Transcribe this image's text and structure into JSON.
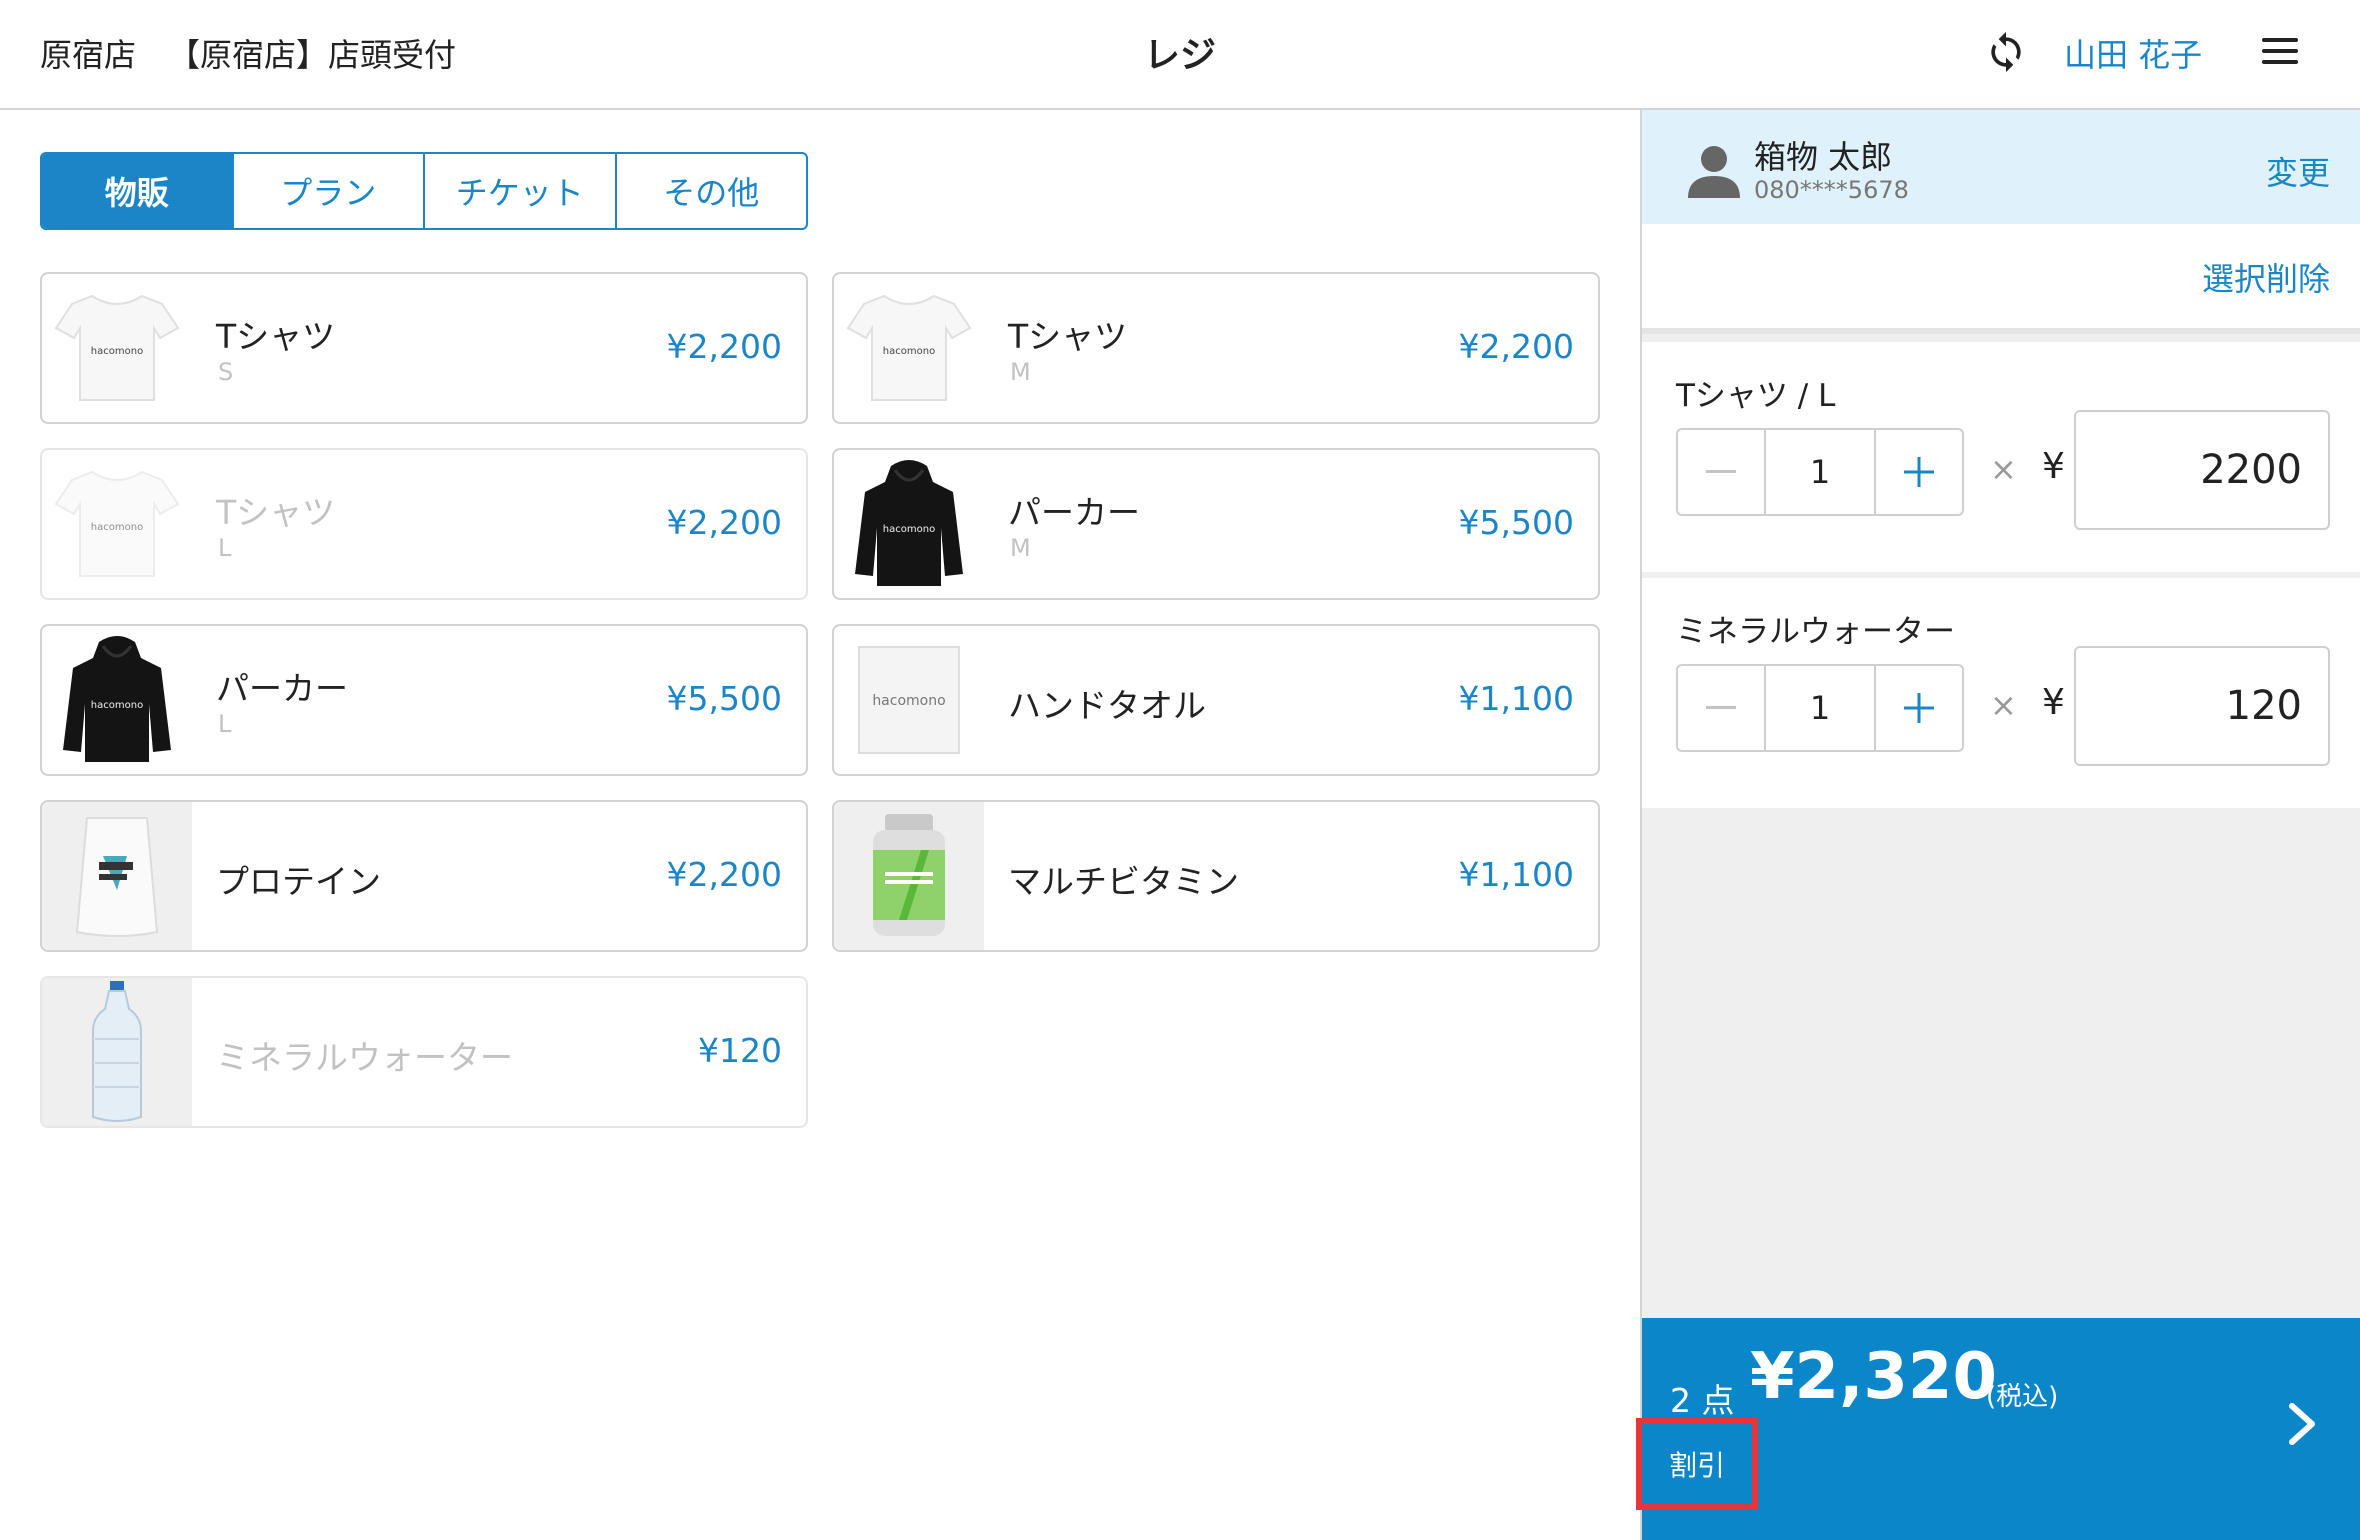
{
  "header": {
    "store": "原宿店",
    "reception": "【原宿店】店頭受付",
    "title": "レジ",
    "user": "山田 花子"
  },
  "tabs": [
    "物販",
    "プラン",
    "チケット",
    "その他"
  ],
  "products": [
    {
      "name": "Tシャツ",
      "variant": "S",
      "price": "¥2,200",
      "icon": "tshirt-white"
    },
    {
      "name": "Tシャツ",
      "variant": "M",
      "price": "¥2,200",
      "icon": "tshirt-white"
    },
    {
      "name": "Tシャツ",
      "variant": "L",
      "price": "¥2,200",
      "icon": "tshirt-white"
    },
    {
      "name": "パーカー",
      "variant": "M",
      "price": "¥5,500",
      "icon": "hoodie-black"
    },
    {
      "name": "パーカー",
      "variant": "L",
      "price": "¥5,500",
      "icon": "hoodie-black"
    },
    {
      "name": "ハンドタオル",
      "variant": "",
      "price": "¥1,100",
      "icon": "towel-white"
    },
    {
      "name": "プロテイン",
      "variant": "",
      "price": "¥2,200",
      "icon": "protein-bag"
    },
    {
      "name": "マルチビタミン",
      "variant": "",
      "price": "¥1,100",
      "icon": "vitamin-bottle"
    },
    {
      "name": "ミネラルウォーター",
      "variant": "",
      "price": "¥120",
      "icon": "water-bottle"
    }
  ],
  "customer": {
    "name": "箱物 太郎",
    "phone": "080****5678",
    "change_label": "変更"
  },
  "delete_selected_label": "選択削除",
  "cart": [
    {
      "name": "Tシャツ / L",
      "qty": "1",
      "times": "×",
      "yen": "¥",
      "price": "2200"
    },
    {
      "name": "ミネラルウォーター",
      "qty": "1",
      "times": "×",
      "yen": "¥",
      "price": "120"
    }
  ],
  "checkout": {
    "count": "2 点",
    "total": "¥2,320",
    "tax_note": "(税込)",
    "discount_label": "割引"
  },
  "logo_text": "hacomono",
  "colors": {
    "accent": "#1a86c8",
    "checkout": "#0a86c9",
    "highlight": "#e8353b"
  }
}
